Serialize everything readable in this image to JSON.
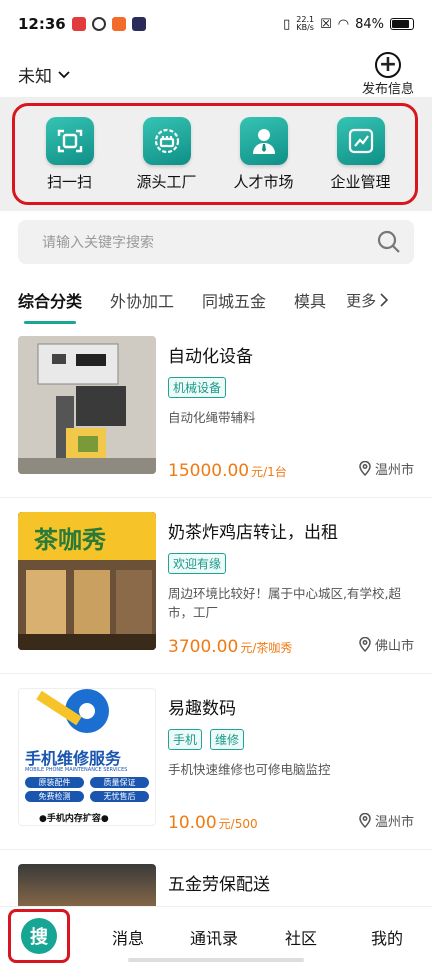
{
  "status": {
    "time": "12:36",
    "speed_top": "22.1",
    "speed_bottom": "KB/s",
    "battery": "84%"
  },
  "header": {
    "location": "未知",
    "publish_label": "发布信息"
  },
  "shortcuts": [
    {
      "label": "扫一扫",
      "icon": "scan-icon"
    },
    {
      "label": "源头工厂",
      "icon": "factory-icon"
    },
    {
      "label": "人才市场",
      "icon": "talent-icon"
    },
    {
      "label": "企业管理",
      "icon": "chart-icon"
    }
  ],
  "search": {
    "placeholder": "请输入关键字搜索"
  },
  "tabs": {
    "items": [
      "综合分类",
      "外协加工",
      "同城五金",
      "模具"
    ],
    "more": "更多"
  },
  "listings": [
    {
      "title": "自动化设备",
      "tags": [
        "机械设备"
      ],
      "desc": "自动化绳带辅料",
      "price": "15000.00",
      "unit": "元/1台",
      "city": "温州市"
    },
    {
      "title": "奶茶炸鸡店转让，出租",
      "tags": [
        "欢迎有缘"
      ],
      "desc": "周边环境比较好！属于中心城区,有学校,超市，工厂",
      "price": "3700.00",
      "unit": "元/茶咖秀",
      "city": "佛山市",
      "image_text": "茶咖秀"
    },
    {
      "title": "易趣数码",
      "tags": [
        "手机",
        "维修"
      ],
      "desc": "手机快速维修也可修电脑监控",
      "price": "10.00",
      "unit": "元/500",
      "city": "温州市",
      "image_text": "手机维修服务",
      "image_sub": "MOBILE PHONE MAINTENANCE SERVICES",
      "image_badges": [
        "原装配件",
        "质量保证",
        "免费检测",
        "无忧售后"
      ],
      "image_footer": "●手机内存扩容●"
    },
    {
      "title": "五金劳保配送"
    }
  ],
  "bottom_nav": {
    "search_label": "搜",
    "items": [
      "消息",
      "通讯录",
      "社区",
      "我的"
    ]
  },
  "colors": {
    "accent": "#1aa597",
    "price": "#f07a12",
    "highlight_border": "#d9161f"
  }
}
